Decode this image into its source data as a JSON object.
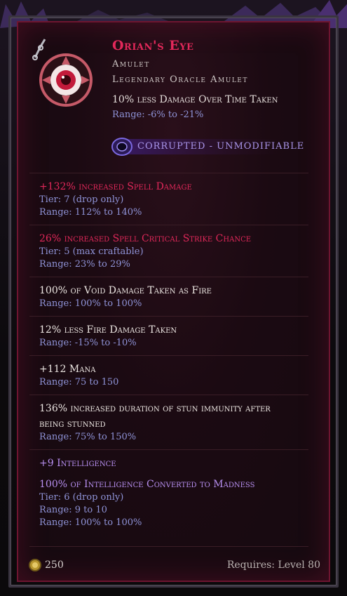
{
  "item": {
    "name": "Orian's Eye",
    "type_line_1": "Amulet",
    "type_line_2": "Legendary Oracle Amulet",
    "implicit": {
      "text": "10% less Damage Over Time Taken",
      "range": "Range: -6% to -21%"
    },
    "corrupted_label": "CORRUPTED - UNMODIFIABLE"
  },
  "affixes": [
    {
      "text": "+132% increased Spell Damage",
      "details": [
        "Tier: 7 (drop only)",
        "Range: 112% to 140%"
      ]
    },
    {
      "text": "26% increased Spell Critical Strike Chance",
      "details": [
        "Tier: 5 (max craftable)",
        "Range: 23% to 29%"
      ]
    },
    {
      "text": "100% of Void Damage Taken as Fire",
      "details": [
        "Range: 100% to 100%"
      ]
    },
    {
      "text": "12% less Fire Damage Taken",
      "details": [
        "Range: -15% to -10%"
      ]
    },
    {
      "text": "+112 Mana",
      "details": [
        "Range: 75 to 150"
      ]
    },
    {
      "text_line1": "136% increased duration of stun immunity after",
      "text_line2": "being stunned",
      "details": [
        "Range: 75% to 150%"
      ]
    },
    {
      "text": "+9 Intelligence",
      "text2": "100% of Intelligence Converted to Madness",
      "details": [
        "Tier: 6 (drop only)",
        "Range: 9 to 10",
        "Range: 100% to 100%"
      ]
    }
  ],
  "footer": {
    "gold": "250",
    "requirement": "Requires: Level 80"
  },
  "colors": {
    "legendary_red": "#e2285a",
    "range_blue": "#8f93d8",
    "corrupted_purple": "#a995ea",
    "set_purple": "#b78ff0"
  }
}
